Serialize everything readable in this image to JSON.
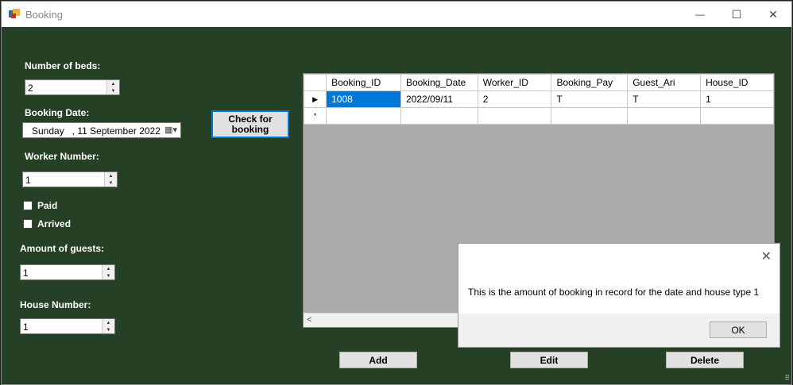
{
  "window": {
    "title": "Booking"
  },
  "titlebar": {
    "minimize": "—",
    "maximize": "☐",
    "close": "✕"
  },
  "form": {
    "beds_label": "Number of beds:",
    "beds_value": "2",
    "date_label": "Booking Date:",
    "date_value": "Sunday   , 11 September 2022",
    "check_button": "Check for booking",
    "worker_label": "Worker Number:",
    "worker_value": "1",
    "paid_label": "Paid",
    "arrived_label": "Arrived",
    "guests_label": "Amount of guests:",
    "guests_value": "1",
    "house_label": "House Number:",
    "house_value": "1"
  },
  "grid": {
    "columns": [
      "Booking_ID",
      "Booking_Date",
      "Worker_ID",
      "Booking_Pay",
      "Guest_Ari",
      "House_ID"
    ],
    "rows": [
      [
        "1008",
        "2022/09/11",
        "2",
        "T",
        "T",
        "1"
      ]
    ],
    "new_row_marker": "*"
  },
  "actions": {
    "add": "Add",
    "edit": "Edit",
    "delete": "Delete"
  },
  "dialog": {
    "message": "This is the amount of booking in record for the date and house type 1",
    "ok": "OK"
  }
}
